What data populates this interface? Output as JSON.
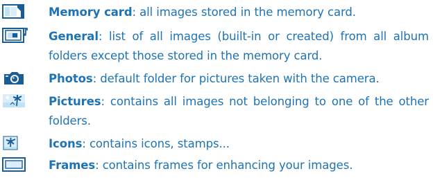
{
  "items": [
    {
      "icon": "memory-card-icon",
      "name": "Memory card",
      "sep": ":",
      "desc": " all images stored in the memory card."
    },
    {
      "icon": "general-album-icon",
      "name": "General",
      "sep": ":",
      "desc": " list of all images (built-in or created) from all album folders except those stored in the memory card."
    },
    {
      "icon": "camera-icon",
      "name": "Photos",
      "sep": ":",
      "desc": " default folder for pictures taken with the camera."
    },
    {
      "icon": "pictures-icon",
      "name": "Pictures",
      "sep": ":",
      "desc": " contains all images not belonging to one of the other folders."
    },
    {
      "icon": "palm-tree-icon",
      "name": "Icons",
      "sep": ":",
      "desc": " contains icons, stamps..."
    },
    {
      "icon": "frame-icon",
      "name": "Frames",
      "sep": ":",
      "desc": " contains frames for enhancing your images."
    }
  ],
  "colors": {
    "text": "#1e73b5",
    "icon_dark": "#1a5d96",
    "icon_light": "#bfe3f6"
  }
}
